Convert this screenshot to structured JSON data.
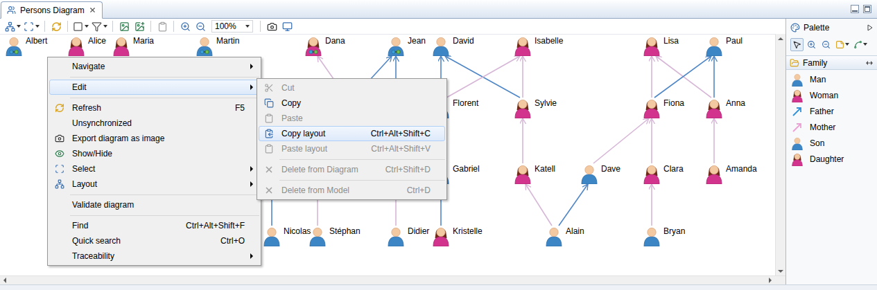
{
  "window": {
    "title": "Persons Diagram"
  },
  "tabs": [
    {
      "label": "Persons Diagram",
      "selected": true
    }
  ],
  "toolbar": {
    "zoom": "100%"
  },
  "diagram": {
    "nodes": [
      {
        "name": "Albert",
        "kind": "man",
        "badge": true
      },
      {
        "name": "Alice",
        "kind": "woman",
        "badge": false
      },
      {
        "name": "Maria",
        "kind": "woman",
        "badge": false
      },
      {
        "name": "Martin",
        "kind": "man",
        "badge": true
      },
      {
        "name": "Dana",
        "kind": "woman",
        "badge": true
      },
      {
        "name": "Jean",
        "kind": "man",
        "badge": true
      },
      {
        "name": "David",
        "kind": "man",
        "badge": false
      },
      {
        "name": "Isabelle",
        "kind": "woman",
        "badge": false
      },
      {
        "name": "Lisa",
        "kind": "woman",
        "badge": false
      },
      {
        "name": "Paul",
        "kind": "man",
        "badge": false
      },
      {
        "name": "Florent",
        "kind": "man",
        "badge": false
      },
      {
        "name": "Sylvie",
        "kind": "woman",
        "badge": false
      },
      {
        "name": "Fiona",
        "kind": "woman",
        "badge": false
      },
      {
        "name": "Anna",
        "kind": "woman",
        "badge": false
      },
      {
        "name": "Gabriel",
        "kind": "man",
        "badge": false
      },
      {
        "name": "Katell",
        "kind": "woman",
        "badge": false
      },
      {
        "name": "Dave",
        "kind": "man",
        "badge": false
      },
      {
        "name": "Clara",
        "kind": "woman",
        "badge": false
      },
      {
        "name": "Amanda",
        "kind": "woman",
        "badge": false
      },
      {
        "name": "Nicolas",
        "kind": "man",
        "badge": false
      },
      {
        "name": "Stéphan",
        "kind": "man",
        "badge": false
      },
      {
        "name": "Didier",
        "kind": "man",
        "badge": false
      },
      {
        "name": "Kristelle",
        "kind": "woman",
        "badge": false
      },
      {
        "name": "Alain",
        "kind": "man",
        "badge": false
      },
      {
        "name": "Bryan",
        "kind": "man",
        "badge": false
      }
    ],
    "edges": [
      {
        "kind": "mother"
      },
      {
        "kind": "father"
      },
      {
        "kind": "father"
      },
      {
        "kind": "father"
      },
      {
        "kind": "father"
      },
      {
        "kind": "mother"
      },
      {
        "kind": "mother"
      },
      {
        "kind": "mother"
      },
      {
        "kind": "mother"
      },
      {
        "kind": "father"
      },
      {
        "kind": "father"
      },
      {
        "kind": "father"
      },
      {
        "kind": "mother"
      },
      {
        "kind": "mother"
      },
      {
        "kind": "mother"
      },
      {
        "kind": "mother"
      },
      {
        "kind": "mother"
      },
      {
        "kind": "father"
      },
      {
        "kind": "mother"
      },
      {
        "kind": "father"
      },
      {
        "kind": "mother"
      },
      {
        "kind": "father"
      },
      {
        "kind": "mother"
      }
    ]
  },
  "context_menu": {
    "items": [
      {
        "kind": "item",
        "label": "Navigate",
        "submenu": true,
        "selected": false,
        "disabled": false
      },
      {
        "kind": "separator"
      },
      {
        "kind": "item",
        "label": "Edit",
        "submenu": true,
        "selected": true,
        "disabled": false
      },
      {
        "kind": "separator"
      },
      {
        "kind": "item",
        "label": "Refresh",
        "shortcut": "F5",
        "submenu": false,
        "selected": false,
        "disabled": false
      },
      {
        "kind": "item",
        "label": "Unsynchronized",
        "submenu": false,
        "selected": false,
        "disabled": false
      },
      {
        "kind": "item",
        "label": "Export diagram as image",
        "submenu": false,
        "selected": false,
        "disabled": false
      },
      {
        "kind": "item",
        "label": "Show/Hide",
        "submenu": false,
        "selected": false,
        "disabled": false
      },
      {
        "kind": "item",
        "label": "Select",
        "submenu": true,
        "selected": false,
        "disabled": false
      },
      {
        "kind": "item",
        "label": "Layout",
        "submenu": true,
        "selected": false,
        "disabled": false
      },
      {
        "kind": "separator"
      },
      {
        "kind": "item",
        "label": "Validate diagram",
        "submenu": false,
        "selected": false,
        "disabled": false
      },
      {
        "kind": "separator"
      },
      {
        "kind": "item",
        "label": "Find",
        "shortcut": "Ctrl+Alt+Shift+F",
        "submenu": false,
        "selected": false,
        "disabled": false
      },
      {
        "kind": "item",
        "label": "Quick search",
        "shortcut": "Ctrl+O",
        "submenu": false,
        "selected": false,
        "disabled": false
      },
      {
        "kind": "item",
        "label": "Traceability",
        "submenu": true,
        "selected": false,
        "disabled": false
      }
    ]
  },
  "edit_submenu": {
    "items": [
      {
        "kind": "item",
        "label": "Cut",
        "submenu": false,
        "selected": false,
        "disabled": true
      },
      {
        "kind": "item",
        "label": "Copy",
        "submenu": false,
        "selected": false,
        "disabled": false
      },
      {
        "kind": "item",
        "label": "Paste",
        "submenu": false,
        "selected": false,
        "disabled": true
      },
      {
        "kind": "item",
        "label": "Copy layout",
        "shortcut": "Ctrl+Alt+Shift+C",
        "submenu": false,
        "selected": true,
        "disabled": false
      },
      {
        "kind": "item",
        "label": "Paste layout",
        "shortcut": "Ctrl+Alt+Shift+V",
        "submenu": false,
        "selected": false,
        "disabled": true
      },
      {
        "kind": "separator"
      },
      {
        "kind": "item",
        "label": "Delete from Diagram",
        "shortcut": "Ctrl+Shift+D",
        "submenu": false,
        "selected": false,
        "disabled": true
      },
      {
        "kind": "separator"
      },
      {
        "kind": "item",
        "label": "Delete from Model",
        "shortcut": "Ctrl+D",
        "submenu": false,
        "selected": false,
        "disabled": true
      }
    ]
  },
  "palette": {
    "title": "Palette",
    "tools": [
      {
        "selected": true
      },
      {
        "selected": false
      },
      {
        "selected": false
      },
      {
        "selected": false
      },
      {
        "selected": false
      }
    ],
    "drawer": {
      "label": "Family",
      "expanded": true
    },
    "entries": [
      {
        "label": "Man",
        "kind": "man"
      },
      {
        "label": "Woman",
        "kind": "woman"
      },
      {
        "label": "Father",
        "kind": "father"
      },
      {
        "label": "Mother",
        "kind": "mother"
      },
      {
        "label": "Son",
        "kind": "son"
      },
      {
        "label": "Daughter",
        "kind": "daughter"
      }
    ]
  }
}
